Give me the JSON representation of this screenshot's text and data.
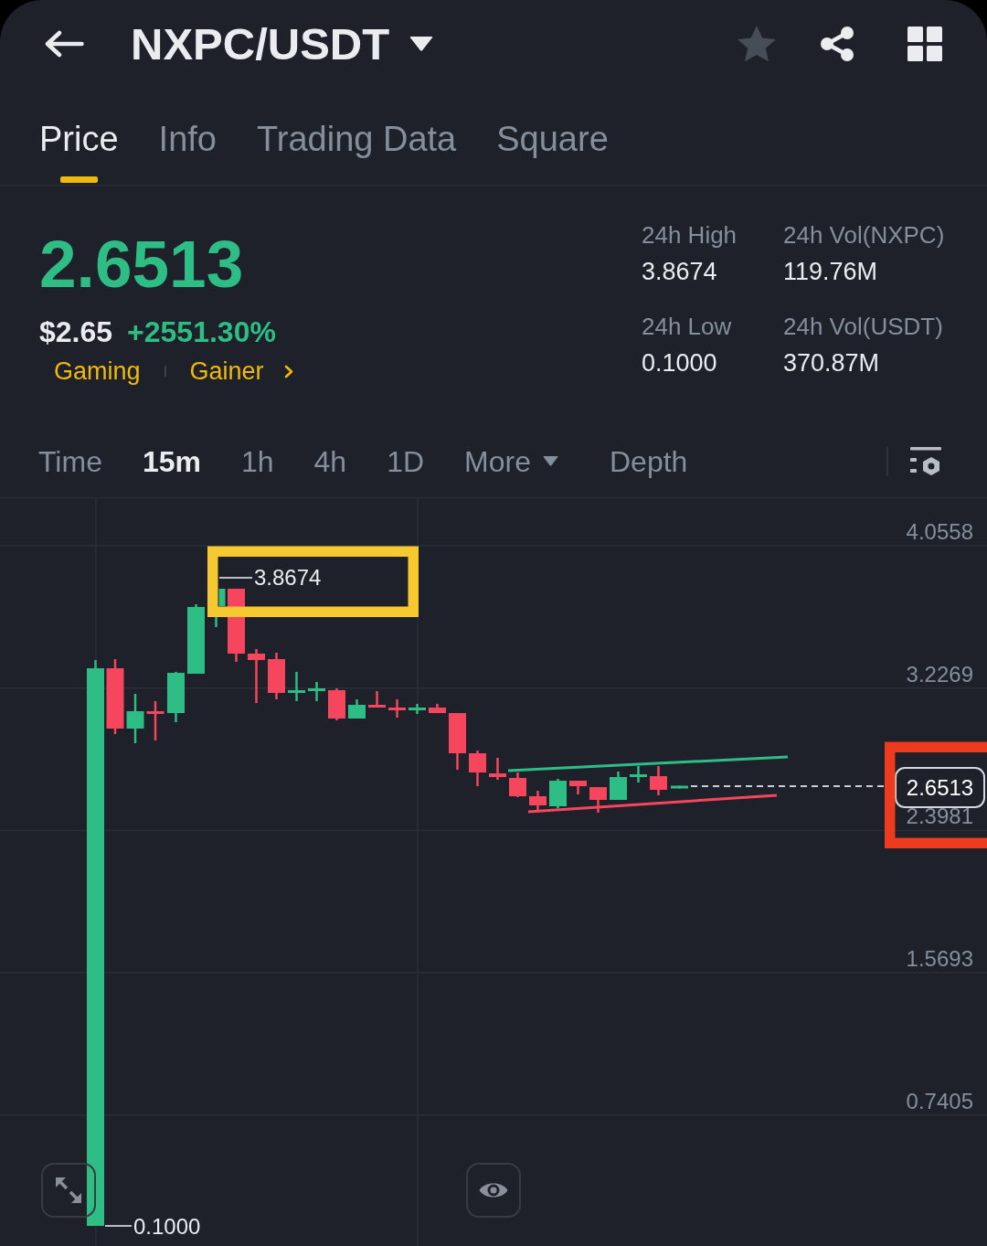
{
  "header": {
    "title": "NXPC/USDT",
    "favorite": false
  },
  "tabs": [
    {
      "label": "Price",
      "selected": true
    },
    {
      "label": "Info",
      "selected": false
    },
    {
      "label": "Trading Data",
      "selected": false
    },
    {
      "label": "Square",
      "selected": false
    }
  ],
  "ticker": {
    "price": "2.6513",
    "fiat_price": "$2.65",
    "change": "+2551.30%",
    "tags": [
      "Gaming",
      "Gainer"
    ],
    "stats": [
      {
        "label": "24h High",
        "value": "3.8674"
      },
      {
        "label": "24h Vol(NXPC)",
        "value": "119.76M"
      },
      {
        "label": "24h Low",
        "value": "0.1000"
      },
      {
        "label": "24h Vol(USDT)",
        "value": "370.87M"
      }
    ]
  },
  "intervals": [
    {
      "label": "Time",
      "kind": "interval",
      "selected": false
    },
    {
      "label": "15m",
      "kind": "interval",
      "selected": true
    },
    {
      "label": "1h",
      "kind": "interval",
      "selected": false
    },
    {
      "label": "4h",
      "kind": "interval",
      "selected": false
    },
    {
      "label": "1D",
      "kind": "interval",
      "selected": false
    },
    {
      "label": "More",
      "kind": "menu",
      "selected": false
    },
    {
      "label": "Depth",
      "kind": "view",
      "selected": false
    }
  ],
  "chart": {
    "price_scale": [
      "4.0558",
      "3.2269",
      "2.3981",
      "1.5693",
      "0.7405"
    ],
    "high_label": "3.8674",
    "low_label": "0.1000",
    "last_price": "2.6513",
    "highlights": [
      {
        "color": "#f7c930"
      },
      {
        "color": "#ec3b1f"
      }
    ]
  }
}
